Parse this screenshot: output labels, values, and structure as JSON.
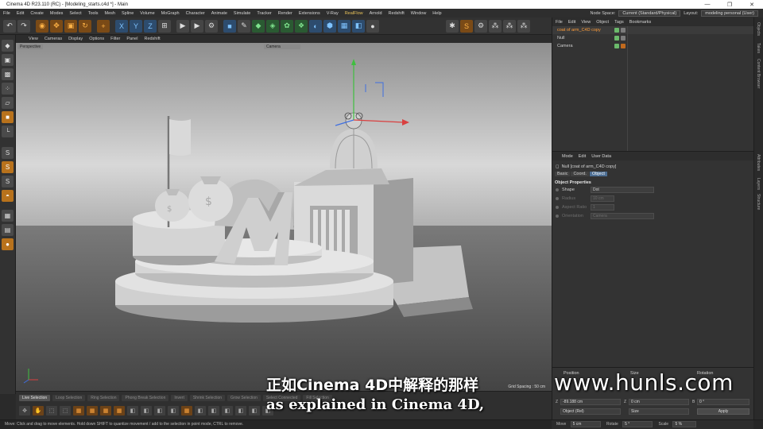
{
  "window": {
    "title": "Cinema 4D R23.110 (RC) - [Modeling_starts.c4d *] - Main",
    "controls": [
      "—",
      "❐",
      "✕"
    ]
  },
  "menubar": {
    "items": [
      "File",
      "Edit",
      "Create",
      "Modes",
      "Select",
      "Tools",
      "Mesh",
      "Spline",
      "Volume",
      "MoGraph",
      "Character",
      "Animate",
      "Simulate",
      "Tracker",
      "Render",
      "Extensions",
      "V-Ray",
      "RealFlow",
      "Arnold",
      "Redshift",
      "Window",
      "Help"
    ],
    "node_space_label": "Node Space:",
    "node_space_value": "Current (Standard/Physical)",
    "layout_label": "Layout:",
    "layout_value": "modeling personal (User)"
  },
  "viewport": {
    "menu": [
      "View",
      "Cameras",
      "Display",
      "Options",
      "Filter",
      "Panel",
      "Redshift"
    ],
    "label": "Perspective",
    "camera_label": "Camera",
    "grid_spacing": "Grid Spacing : 50 cm"
  },
  "selection_tabs": [
    "Live Selection",
    "Loop Selection",
    "Ring Selection",
    "Phong Break Selection",
    "Invert",
    "Shrink Selection",
    "Grow Selection",
    "Select Connected",
    "Fill Selection"
  ],
  "status": "Move: Click and drag to move elements. Hold down SHIFT to quantize movement / add to the selection in point mode, CTRL to remove.",
  "object_manager": {
    "menu": [
      "File",
      "Edit",
      "View",
      "Object",
      "Tags",
      "Bookmarks"
    ],
    "objects": [
      {
        "name": "coat of arm_C4D copy",
        "selected": true,
        "icon": "null-icon"
      },
      {
        "name": "Null",
        "selected": false,
        "icon": "null-icon"
      },
      {
        "name": "Camera",
        "selected": false,
        "icon": "camera-icon"
      }
    ]
  },
  "attributes": {
    "menu": [
      "Mode",
      "Edit",
      "User Data"
    ],
    "object": "Null [coat of arm_C4D copy]",
    "tabs": [
      "Basic",
      "Coord.",
      "Object"
    ],
    "active_tab": "Object",
    "section": "Object Properties",
    "props": [
      {
        "label": "Shape",
        "value": "Dot",
        "enabled": true
      },
      {
        "label": "Radius",
        "value": "10 cm",
        "enabled": false
      },
      {
        "label": "Aspect Ratio",
        "value": "1",
        "enabled": false
      },
      {
        "label": "Orientation",
        "value": "Camera",
        "enabled": false
      }
    ]
  },
  "coordinates": {
    "headers": [
      "Position",
      "Size",
      "Rotation"
    ],
    "z_label": "Z",
    "z_pos": "-89.188 cm",
    "z_size": "0 cm",
    "b_label": "B",
    "b_rot": "0 °",
    "mode_select": "Object (Rel)",
    "size_select": "Size",
    "apply": "Apply",
    "move_label": "Move",
    "move_value": "5 cm",
    "rotate_label": "Rotate",
    "rotate_value": "5 °",
    "scale_label": "Scale",
    "scale_value": "5 %"
  },
  "right_strip_tabs": [
    "Objects",
    "Takes",
    "Content Browser",
    "Attributes",
    "Layers",
    "Structure"
  ],
  "subtitle": {
    "zh": "正如Cinema 4D中解释的那样",
    "en": "as explained in Cinema 4D,"
  },
  "watermark": "www.hunls.com"
}
